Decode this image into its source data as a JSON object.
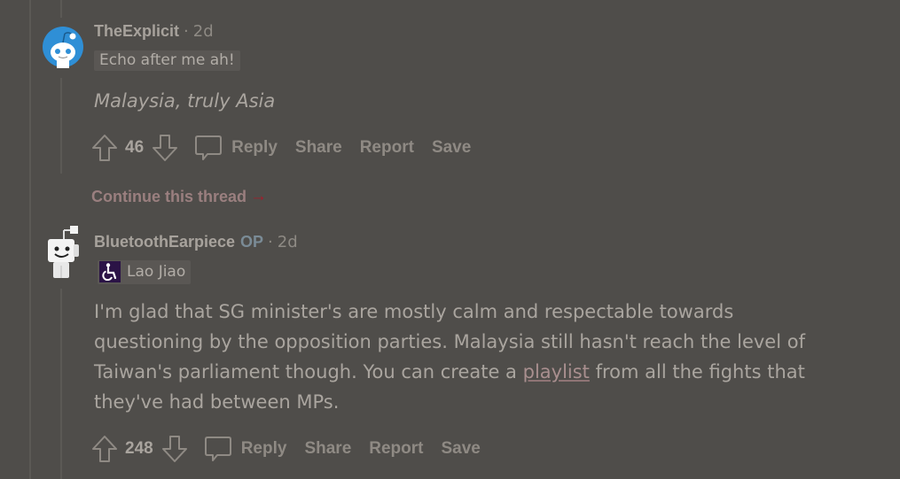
{
  "comments": [
    {
      "username": "TheExplicit",
      "is_op": false,
      "separator": "·",
      "time": "2d",
      "flair": {
        "text": "Echo after me ah!",
        "emoji": null
      },
      "body": "Malaysia, truly Asia",
      "body_italic": true,
      "score": "46",
      "actions": [
        "Reply",
        "Share",
        "Report",
        "Save"
      ],
      "avatar": "snoo-blue-avatar"
    },
    {
      "username": "BluetoothEarpiece",
      "is_op": true,
      "op_label": "OP",
      "separator": "·",
      "time": "2d",
      "flair": {
        "text": "Lao Jiao",
        "emoji": "wheelchair-icon",
        "emoji_bg": "#2b1346"
      },
      "body_lines": [
        "I'm glad that SG minister's are mostly calm and respectable towards",
        "questioning by the opposition parties. Malaysia still hasn't reach the level of"
      ],
      "body_line3_before": "Taiwan's parliament though. You can create a ",
      "body_link": "playlist",
      "body_line3_after": " from all the fights that",
      "body_line4": "they've had between MPs.",
      "score": "248",
      "actions": [
        "Reply",
        "Share",
        "Report",
        "Save"
      ],
      "avatar": "snoo-robot-avatar"
    }
  ],
  "continue_thread": {
    "label": "Continue this thread",
    "arrow": "→"
  },
  "colors": {
    "background": "#4f4d4a",
    "link": "#a98f8f",
    "continue_arrow": "#a31d2b",
    "op": "#7a8b96"
  }
}
